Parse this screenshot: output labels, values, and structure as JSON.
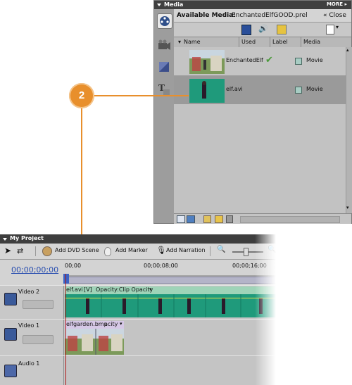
{
  "media_panel": {
    "title": "Media",
    "more": "MORE",
    "available_label": "Available Media:",
    "project_file": "EnchantedElfGOOD.prel",
    "close": "Close",
    "columns": {
      "name": "Name",
      "used": "Used",
      "label": "Label",
      "media": "Media"
    },
    "items": [
      {
        "name": "EnchantedElf",
        "media": "Movie",
        "used": true
      },
      {
        "name": "elf.avi",
        "media": "Movie",
        "used": false
      }
    ]
  },
  "callout": {
    "number": "2"
  },
  "project_panel": {
    "title": "My Project",
    "toolbar": {
      "add_dvd_scene": "Add DVD Scene",
      "add_marker": "Add Marker",
      "add_narration": "Add Narration"
    },
    "timecode": "00;00;00;00",
    "ruler": {
      "start": "00;00",
      "mark_8": "00;00;08;00",
      "mark_16": "00;00;16;00"
    },
    "tracks": [
      {
        "name": "Video 2",
        "clip": "elf.avi",
        "clip_tag": "[V]",
        "clip_effect": "Opacity:Clip Opacity"
      },
      {
        "name": "Video 1",
        "clip": "elfgarden.bmp",
        "clip_effect": "acity"
      },
      {
        "name": "Audio 1"
      }
    ]
  },
  "colors": {
    "callout": "#e88f2c",
    "clip_green": "#1f9a7b",
    "selected_row": "#9a9a9a",
    "playhead": "#b01818"
  }
}
